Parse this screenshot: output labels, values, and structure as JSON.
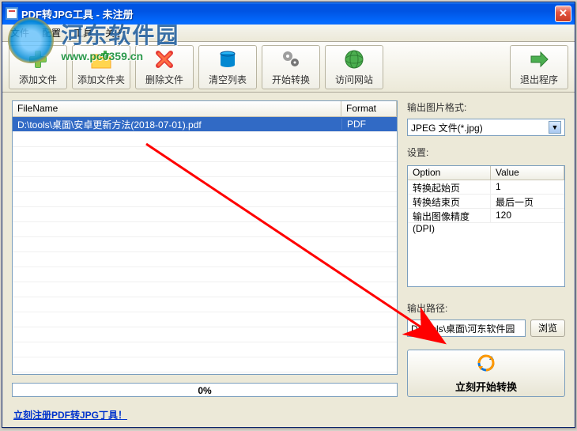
{
  "window": {
    "title": "PDF转JPG工具 - 未注册"
  },
  "menu": {
    "file": "文件",
    "edit": "配置",
    "tools": "工具",
    "about": "关于"
  },
  "watermark": {
    "cn": "河东软件园",
    "url": "www.pc0359.cn"
  },
  "toolbar": {
    "add_file": "添加文件",
    "add_folder": "添加文件夹",
    "delete_file": "删除文件",
    "clear_list": "清空列表",
    "start_convert": "开始转换",
    "visit_site": "访问网站",
    "exit": "退出程序"
  },
  "table": {
    "col_filename": "FileName",
    "col_format": "Format",
    "rows": [
      {
        "name": "D:\\tools\\桌面\\安卓更新方法(2018-07-01).pdf",
        "format": "PDF"
      }
    ]
  },
  "progress": {
    "text": "0%"
  },
  "right": {
    "format_label": "输出图片格式:",
    "format_value": "JPEG 文件(*.jpg)",
    "settings_label": "设置:",
    "settings_head_option": "Option",
    "settings_head_value": "Value",
    "settings_rows": [
      {
        "opt": "转换起始页",
        "val": "1"
      },
      {
        "opt": "转换结束页",
        "val": "最后一页"
      },
      {
        "opt": "输出图像精度(DPI)",
        "val": "120"
      }
    ],
    "path_label": "输出路径:",
    "path_value": "D:\\tools\\桌面\\河东软件园",
    "browse": "浏览",
    "start_now": "立刻开始转换"
  },
  "footer": {
    "register": "立刻注册PDF转JPG丁具！"
  }
}
